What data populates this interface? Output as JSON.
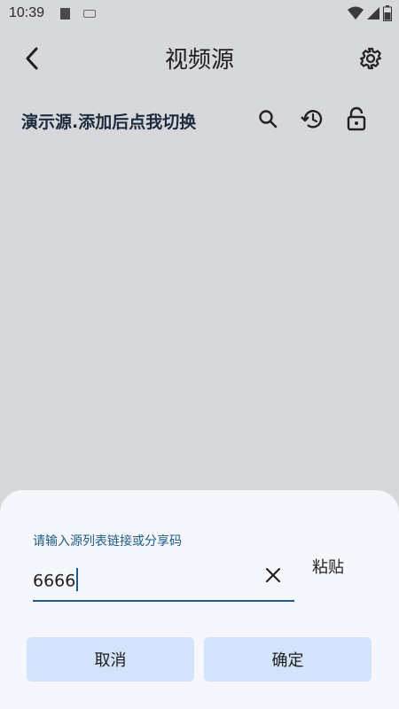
{
  "status_bar": {
    "time": "10:39",
    "icons": [
      "notification-a-icon",
      "keyboard-icon",
      "wifi-icon",
      "cellular-icon",
      "battery-icon"
    ]
  },
  "toolbar": {
    "title": "视频源",
    "back_icon": "chevron-left-icon",
    "settings_icon": "gear-icon"
  },
  "source_row": {
    "current_source": "演示源.添加后点我切换",
    "icons": [
      "search-icon",
      "history-icon",
      "lock-icon"
    ]
  },
  "dialog": {
    "input_label": "请输入源列表链接或分享码",
    "input_value": "6666",
    "paste_label": "粘贴",
    "cancel_label": "取消",
    "confirm_label": "确定"
  },
  "colors": {
    "background": "#d7d8dc",
    "sheet": "#f5f7fc",
    "accent": "#1d5a8a",
    "button": "#d2e3fb"
  }
}
